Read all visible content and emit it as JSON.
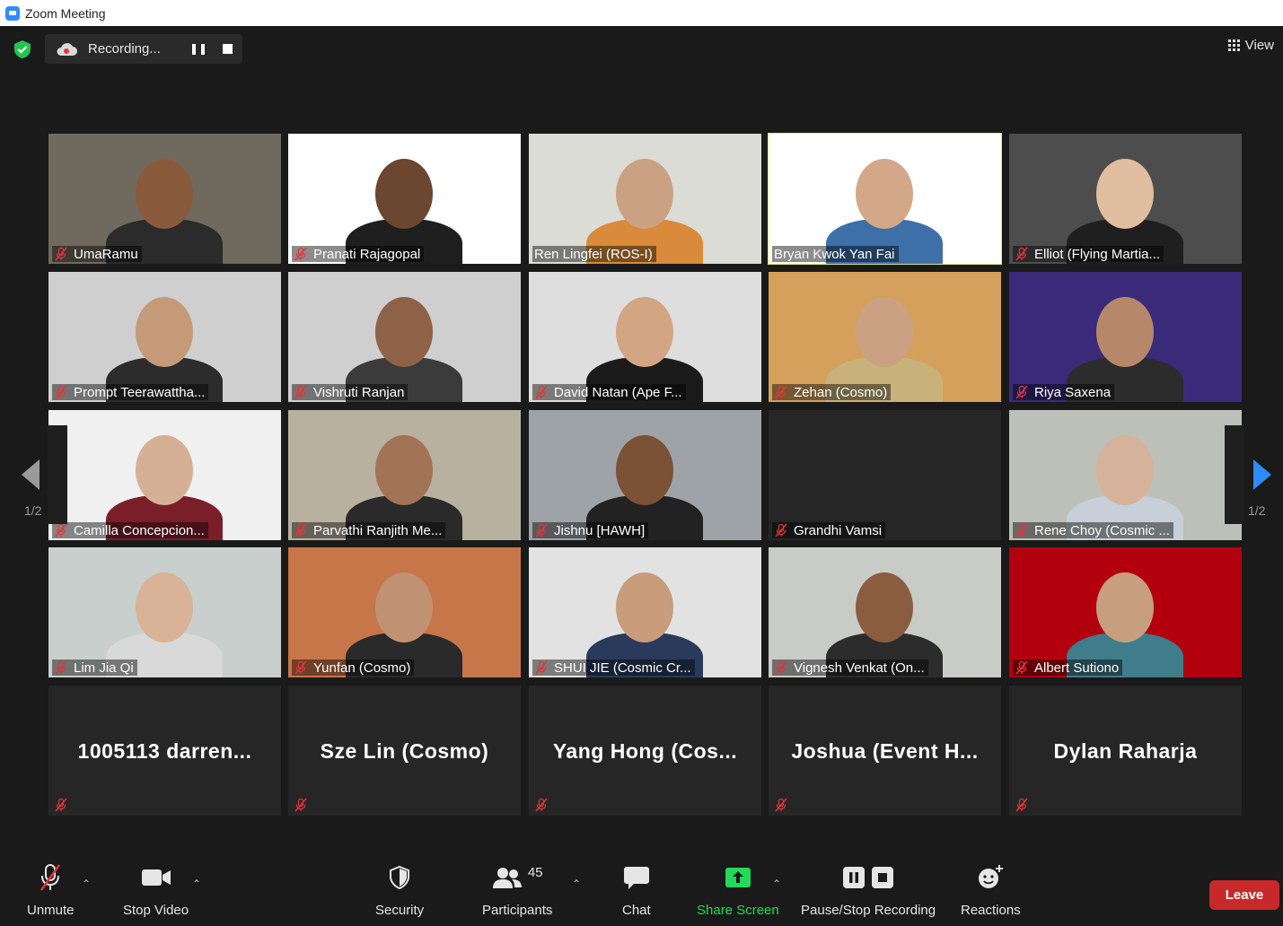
{
  "window": {
    "title": "Zoom Meeting"
  },
  "recording": {
    "status": "Recording..."
  },
  "view_label": "View",
  "page_indicator": {
    "left": "1/2",
    "right": "1/2"
  },
  "video_tiles": [
    {
      "name": "UmaRamu",
      "bg": "#6f6a5d",
      "skin": "#8a5a3c",
      "shirt": "#2b2b2b"
    },
    {
      "name": "Pranati Rajagopal",
      "bg": "#ffffff",
      "skin": "#6b4630",
      "shirt": "#1e1e1e"
    },
    {
      "name": "Ren Lingfei (ROS-I)",
      "bg": "#dcdcd6",
      "skin": "#caa283",
      "shirt": "#d98a3a"
    },
    {
      "name": "Bryan Kwok Yan Fai",
      "bg": "#ffffff",
      "skin": "#d2a889",
      "shirt": "#3f6fa8"
    },
    {
      "name": "Elliot (Flying Martia...",
      "bg": "#4d4d4d",
      "skin": "#e1bea0",
      "shirt": "#1f1f1f"
    },
    {
      "name": "Prompt Teerawattha...",
      "bg": "#cfcfcf",
      "skin": "#c59a79",
      "shirt": "#2c2c2c"
    },
    {
      "name": "Vishruti Ranjan",
      "bg": "#cfcfcf",
      "skin": "#8e6247",
      "shirt": "#3b3b3b"
    },
    {
      "name": "David Natan (Ape F...",
      "bg": "#dedede",
      "skin": "#d2a583",
      "shirt": "#1b1b1b"
    },
    {
      "name": "Zehan (Cosmo)",
      "bg": "#d4a05c",
      "skin": "#caa283",
      "shirt": "#c8b27a"
    },
    {
      "name": "Riya Saxena",
      "bg": "#3a2a7a",
      "skin": "#b7876a",
      "shirt": "#2c2c2c"
    },
    {
      "name": "Camilla Concepcion...",
      "bg": "#f0f0f0",
      "skin": "#d6b095",
      "shirt": "#7a1f2a"
    },
    {
      "name": "Parvathi Ranjith Me...",
      "bg": "#b8b19f",
      "skin": "#a27356",
      "shirt": "#2a2a2a"
    },
    {
      "name": "Jishnu [HAWH]",
      "bg": "#9ea3a8",
      "skin": "#7b5236",
      "shirt": "#222222"
    },
    {
      "name": "Grandhi Vamsi",
      "bg": "#262626",
      "skin": "",
      "shirt": ""
    },
    {
      "name": "Rene Choy (Cosmic ...",
      "bg": "#bcc0b8",
      "skin": "#d6b29a",
      "shirt": "#c7cfd8"
    },
    {
      "name": "Lim Jia Qi",
      "bg": "#c9cfcd",
      "skin": "#d8b397",
      "shirt": "#d9d9d9"
    },
    {
      "name": "Yunfan (Cosmo)",
      "bg": "#c7764a",
      "skin": "#c09173",
      "shirt": "#2a2a2a"
    },
    {
      "name": "SHUI JIE (Cosmic Cr...",
      "bg": "#e2e2e2",
      "skin": "#c99c7c",
      "shirt": "#2a3a5c"
    },
    {
      "name": "Vignesh Venkat (On...",
      "bg": "#c9cbc7",
      "skin": "#8a5d41",
      "shirt": "#2c2c2c"
    },
    {
      "name": "Albert Sutiono",
      "bg": "#b3000f",
      "skin": "#c89e80",
      "shirt": "#3f7d8a"
    }
  ],
  "name_tiles": [
    {
      "name": "1005113 darren..."
    },
    {
      "name": "Sze Lin (Cosmo)"
    },
    {
      "name": "Yang Hong (Cos..."
    },
    {
      "name": "Joshua (Event H..."
    },
    {
      "name": "Dylan Raharja"
    }
  ],
  "toolbar": {
    "unmute": "Unmute",
    "stop_video": "Stop Video",
    "security": "Security",
    "participants": "Participants",
    "participants_count": "45",
    "chat": "Chat",
    "share_screen": "Share Screen",
    "pause_stop_recording": "Pause/Stop Recording",
    "reactions": "Reactions",
    "leave": "Leave"
  },
  "colors": {
    "accent_blue": "#2d8cff",
    "share_green": "#23d959",
    "leave_red": "#c7292b",
    "active_speaker": "#d9ea7d",
    "muted_red": "#e0363b"
  }
}
